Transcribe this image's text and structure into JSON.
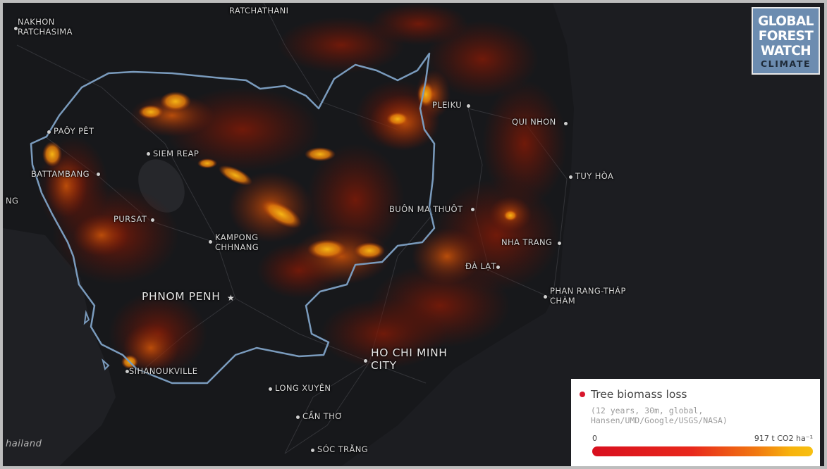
{
  "logo": {
    "line1": "GLOBAL",
    "line2": "FOREST",
    "line3": "WATCH",
    "line4": "CLIMATE"
  },
  "legend": {
    "title": "Tree biomass loss",
    "subtitle_line1": "(12 years, 30m, global,",
    "subtitle_line2": "Hansen/UMD/Google/USGS/NASA)",
    "scale_min": "0",
    "scale_max": "917 t CO2 ha⁻¹",
    "accent_color": "#d8162c",
    "gradient_colors": [
      "#d80f1e",
      "#e8281c",
      "#f17a10",
      "#f7b30c",
      "#f7c012"
    ]
  },
  "colors": {
    "background": "#1c1d21",
    "border_line": "#7a9bbd",
    "loss_low": "#6a1408",
    "loss_mid": "#a33a08",
    "loss_high": "#f2a80e"
  },
  "cities": [
    {
      "name": "RATCHATHANI"
    },
    {
      "name": "NAKHON\nRATCHASIMA"
    },
    {
      "name": "PAÔY PÊT"
    },
    {
      "name": "SIEM REAP"
    },
    {
      "name": "BATTAMBANG"
    },
    {
      "name": "NG"
    },
    {
      "name": "PURSAT"
    },
    {
      "name": "KAMPONG\nCHHNANG"
    },
    {
      "name": "PHNOM PENH"
    },
    {
      "name": "SIHANOUKVILLE"
    },
    {
      "name": "HO CHI MINH\nCITY"
    },
    {
      "name": "LONG XUYÊN"
    },
    {
      "name": "CẦN THƠ"
    },
    {
      "name": "SÓC TRĂNG"
    },
    {
      "name": "PLEIKU"
    },
    {
      "name": "QUI NHON"
    },
    {
      "name": "TUY HÒA"
    },
    {
      "name": "BUÔN MA THUÔT"
    },
    {
      "name": "NHA TRANG"
    },
    {
      "name": "ĐÀ LẠT"
    },
    {
      "name": "PHAN RANG-THÁP\nCHÀM"
    }
  ],
  "region_labels": [
    {
      "name": "hailand"
    }
  ]
}
